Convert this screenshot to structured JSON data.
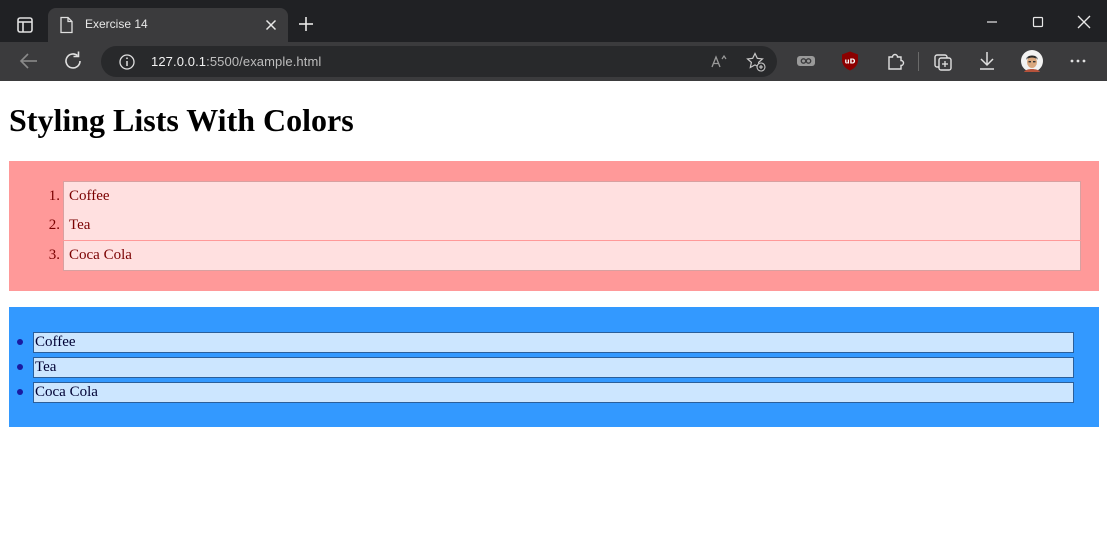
{
  "browser": {
    "tab": {
      "title": "Exercise 14"
    },
    "address": {
      "host": "127.0.0.1",
      "path": ":5500/example.html"
    }
  },
  "page": {
    "heading": "Styling Lists With Colors",
    "ordered_list": {
      "bg_color": "#ff9999",
      "item_bg_color": "#ffe0e0",
      "text_color": "#7a0000",
      "items": [
        {
          "marker": "1.",
          "label": "Coffee"
        },
        {
          "marker": "2.",
          "label": "Tea"
        },
        {
          "marker": "3.",
          "label": "Coca Cola"
        }
      ]
    },
    "unordered_list": {
      "bg_color": "#3399ff",
      "item_bg_color": "#cce6ff",
      "items": [
        {
          "label": "Coffee"
        },
        {
          "label": "Tea"
        },
        {
          "label": "Coca Cola"
        }
      ]
    }
  },
  "icons": {
    "tab_actions": "tab-actions-icon",
    "document": "document-icon",
    "close": "close-icon",
    "new_tab": "plus-icon",
    "back": "back-arrow-icon",
    "refresh": "refresh-icon",
    "info": "info-icon",
    "read_aloud": "read-aloud-icon",
    "favorites": "add-favorite-icon",
    "extensions": "puzzle-icon"
  }
}
